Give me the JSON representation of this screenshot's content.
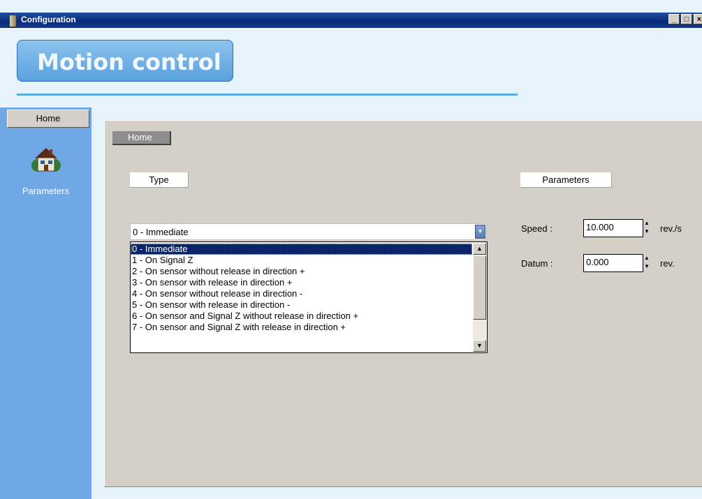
{
  "window": {
    "title": "Configuration",
    "buttons": [
      "minimize",
      "maximize",
      "close"
    ]
  },
  "header": {
    "banner_text": "Motion control"
  },
  "sidebar": {
    "tab_label": "Home",
    "items": [
      {
        "icon": "house-icon",
        "label": "Parameters"
      }
    ]
  },
  "main": {
    "breadcrumb": "Home",
    "type_section": {
      "label": "Type",
      "combo_value": "0 - Immediate",
      "options": [
        "0 - Immediate",
        "1 - On Signal Z",
        "2 - On sensor without release in direction +",
        "3 - On sensor with release in direction +",
        "4 - On sensor without release in direction -",
        "5 - On sensor with release in direction -",
        "6 - On sensor and Signal Z without release in direction +",
        "7 - On sensor and Signal Z with release in direction +"
      ],
      "selected_index": 0
    },
    "parameters_section": {
      "label": "Parameters",
      "speed": {
        "label": "Speed :",
        "value": "10.000",
        "unit": "rev./s"
      },
      "datum": {
        "label": "Datum :",
        "value": "0.000",
        "unit": "rev."
      }
    }
  },
  "colors": {
    "titlebar": "#0a2a78",
    "sidebar": "#6fa8e4",
    "panel": "#d4d0c8",
    "selection": "#0a246a",
    "banner": "#6aaee6"
  }
}
